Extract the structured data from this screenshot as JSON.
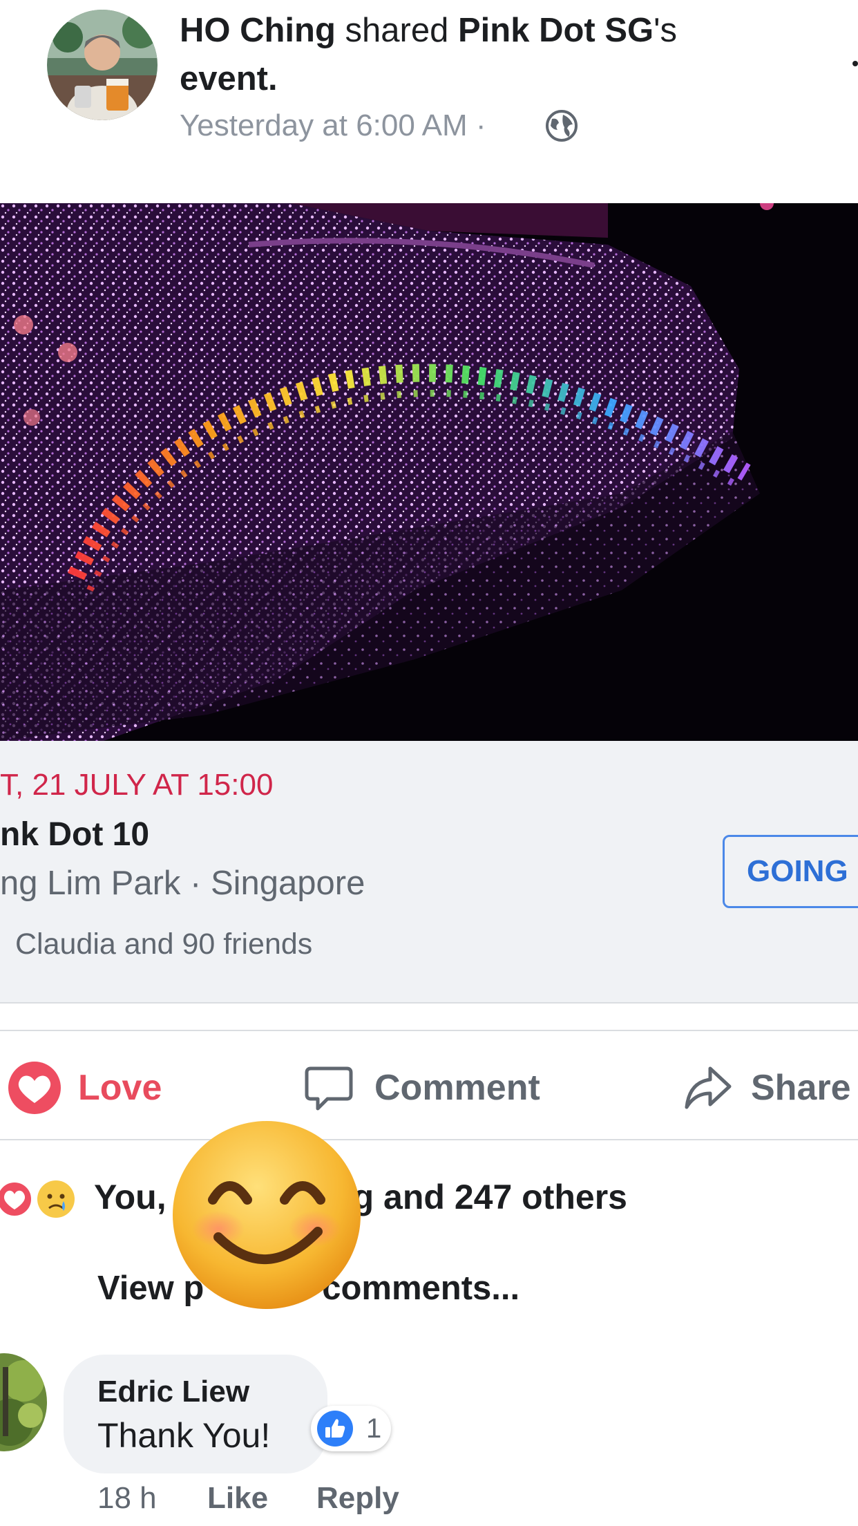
{
  "post": {
    "author": "HO Ching",
    "verb": "shared",
    "page_name": "Pink Dot SG",
    "possessive": "'s",
    "object_line": "event.",
    "timestamp": "Yesterday at 6:00 AM",
    "separator": "·",
    "privacy_icon": "globe-icon"
  },
  "event": {
    "date": "T, 21 JULY AT 15:00",
    "title": "nk Dot 10",
    "place": "ng Lim Park · Singapore",
    "friends": "Claudia and 90 friends",
    "going_button": "GOING"
  },
  "actions": {
    "love": "Love",
    "comment": "Comment",
    "share": "Share"
  },
  "reactions": {
    "icons": [
      "heart-icon",
      "crying-face-icon"
    ],
    "summary_left": "You,",
    "summary_right": "g and 247 others"
  },
  "comments": {
    "view_previous_left": "View p",
    "view_previous_right": "s comments...",
    "items": [
      {
        "name": "Edric Liew",
        "text": "Thank You!",
        "likes": "1",
        "age": "18 h",
        "like_label": "Like",
        "reply_label": "Reply"
      }
    ]
  },
  "colors": {
    "love": "#e84b5d",
    "event_date": "#d0264a",
    "going": "#2d6fd6",
    "muted": "#606770"
  }
}
